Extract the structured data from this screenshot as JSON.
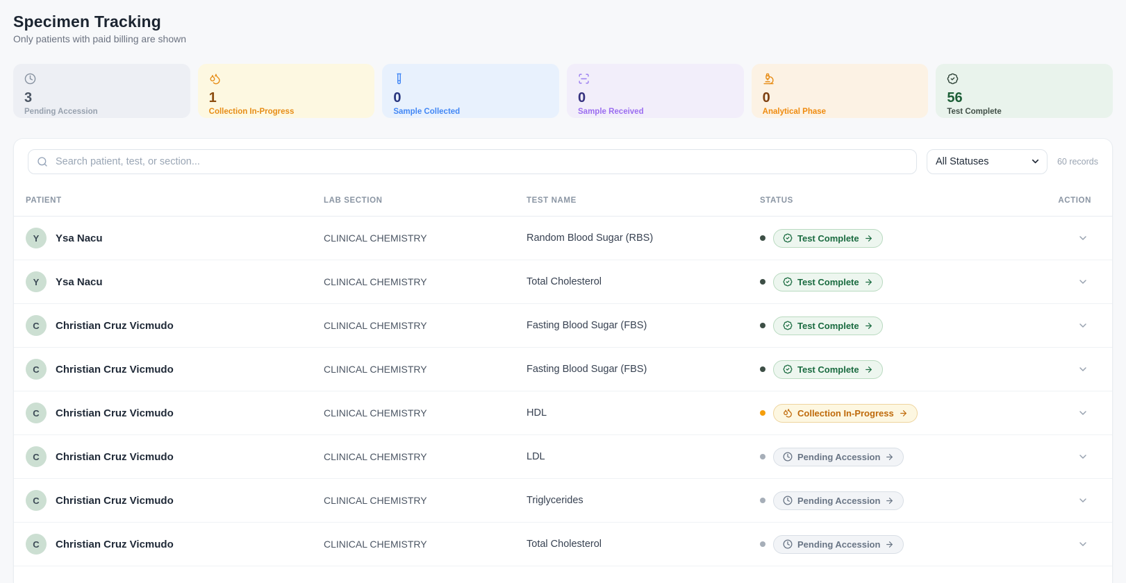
{
  "page": {
    "title": "Specimen Tracking",
    "subtitle": "Only patients with paid billing are shown"
  },
  "stats": [
    {
      "icon": "clock",
      "count": "3",
      "label": "Pending Accession",
      "card_bg": "#edeff4",
      "icon_color": "#8792a0",
      "count_color": "#4b5563",
      "label_color": "#97a1ae"
    },
    {
      "icon": "droplets",
      "count": "1",
      "label": "Collection In-Progress",
      "card_bg": "#fdf8e1",
      "icon_color": "#e78d17",
      "count_color": "#8c4d10",
      "label_color": "#e78d17"
    },
    {
      "icon": "test-tube",
      "count": "0",
      "label": "Sample Collected",
      "card_bg": "#e8f1fd",
      "icon_color": "#4287f5",
      "count_color": "#27357e",
      "label_color": "#4287f5"
    },
    {
      "icon": "scan-line",
      "count": "0",
      "label": "Sample Received",
      "card_bg": "#f2eefa",
      "icon_color": "#9b7ef0",
      "count_color": "#35317e",
      "label_color": "#9b6df0"
    },
    {
      "icon": "microscope",
      "count": "0",
      "label": "Analytical Phase",
      "card_bg": "#fcf2e4",
      "icon_color": "#e78d17",
      "count_color": "#7d3f10",
      "label_color": "#ef8b0f"
    },
    {
      "icon": "badge-check",
      "count": "56",
      "label": "Test Complete",
      "card_bg": "#e9f3ec",
      "icon_color": "#31453a",
      "count_color": "#1c5e36",
      "label_color": "#414f47"
    }
  ],
  "toolbar": {
    "search_placeholder": "Search patient, test, or section...",
    "status_filter_value": "All Statuses",
    "records_text": "60 records"
  },
  "table": {
    "columns": [
      "PATIENT",
      "LAB SECTION",
      "TEST NAME",
      "STATUS",
      "ACTION"
    ],
    "rows": [
      {
        "initial": "Y",
        "name": "Ysa Nacu",
        "section": "CLINICAL CHEMISTRY",
        "test": "Random Blood Sugar (RBS)",
        "status": "complete"
      },
      {
        "initial": "Y",
        "name": "Ysa Nacu",
        "section": "CLINICAL CHEMISTRY",
        "test": "Total Cholesterol",
        "status": "complete"
      },
      {
        "initial": "C",
        "name": "Christian Cruz Vicmudo",
        "section": "CLINICAL CHEMISTRY",
        "test": "Fasting Blood Sugar (FBS)",
        "status": "complete"
      },
      {
        "initial": "C",
        "name": "Christian Cruz Vicmudo",
        "section": "CLINICAL CHEMISTRY",
        "test": "Fasting Blood Sugar (FBS)",
        "status": "complete"
      },
      {
        "initial": "C",
        "name": "Christian Cruz Vicmudo",
        "section": "CLINICAL CHEMISTRY",
        "test": "HDL",
        "status": "inprogress"
      },
      {
        "initial": "C",
        "name": "Christian Cruz Vicmudo",
        "section": "CLINICAL CHEMISTRY",
        "test": "LDL",
        "status": "pending"
      },
      {
        "initial": "C",
        "name": "Christian Cruz Vicmudo",
        "section": "CLINICAL CHEMISTRY",
        "test": "Triglycerides",
        "status": "pending"
      },
      {
        "initial": "C",
        "name": "Christian Cruz Vicmudo",
        "section": "CLINICAL CHEMISTRY",
        "test": "Total Cholesterol",
        "status": "pending"
      }
    ]
  },
  "statuses": {
    "complete": {
      "label": "Test Complete",
      "icon": "badge-check",
      "dot": "#3d4f46",
      "bg": "#edf6ef",
      "border": "#b9dac0",
      "text": "#1a6b40"
    },
    "inprogress": {
      "label": "Collection In-Progress",
      "icon": "droplets",
      "dot": "#f59e0b",
      "bg": "#fdf7e1",
      "border": "#eed49e",
      "text": "#bf6a0b"
    },
    "pending": {
      "label": "Pending Accession",
      "icon": "clock",
      "dot": "#a6aeb8",
      "bg": "#f2f4f7",
      "border": "#d8dee5",
      "text": "#697585"
    }
  }
}
